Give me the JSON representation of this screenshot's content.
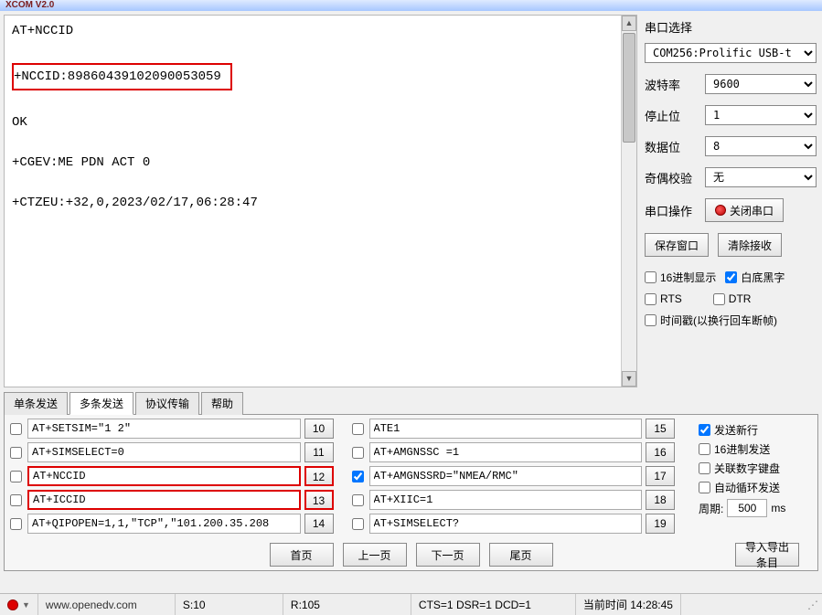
{
  "window_title": "XCOM V2.0",
  "terminal": {
    "lines": [
      "AT+NCCID",
      "",
      "+NCCID:89860439102090053059",
      "",
      "OK",
      "",
      "+CGEV:ME PDN ACT 0",
      "",
      "+CTZEU:+32,0,2023/02/17,06:28:47"
    ],
    "highlight_index": 2
  },
  "side": {
    "title": "串口选择",
    "port": "COM256:Prolific USB-t",
    "baud_label": "波特率",
    "baud": "9600",
    "stop_label": "停止位",
    "stop": "1",
    "data_label": "数据位",
    "data": "8",
    "parity_label": "奇偶校验",
    "parity": "无",
    "op_label": "串口操作",
    "op_button": "关闭串口",
    "save_btn": "保存窗口",
    "clear_btn": "清除接收",
    "hex_disp": "16进制显示",
    "white_text": "白底黑字",
    "hex_disp_checked": false,
    "white_text_checked": true,
    "rts": "RTS",
    "dtr": "DTR",
    "rts_checked": false,
    "dtr_checked": false,
    "ts_label": "时间戳(以换行回车断帧)",
    "ts_checked": false
  },
  "tabs": {
    "items": [
      "单条发送",
      "多条发送",
      "协议传输",
      "帮助"
    ],
    "active": 1
  },
  "send": {
    "left": [
      {
        "checked": false,
        "text": "AT+SETSIM=\"1 2\"",
        "num": "10",
        "mark": false
      },
      {
        "checked": false,
        "text": "AT+SIMSELECT=0",
        "num": "11",
        "mark": false
      },
      {
        "checked": false,
        "text": "AT+NCCID",
        "num": "12",
        "mark": true
      },
      {
        "checked": false,
        "text": "AT+ICCID",
        "num": "13",
        "mark": true
      },
      {
        "checked": false,
        "text": "AT+QIPOPEN=1,1,\"TCP\",\"101.200.35.208",
        "num": "14",
        "mark": false
      }
    ],
    "right": [
      {
        "checked": false,
        "text": "ATE1",
        "num": "15"
      },
      {
        "checked": false,
        "text": "AT+AMGNSSC =1",
        "num": "16"
      },
      {
        "checked": true,
        "text": "AT+AMGNSSRD=\"NMEA/RMC\"",
        "num": "17"
      },
      {
        "checked": false,
        "text": "AT+XIIC=1",
        "num": "18"
      },
      {
        "checked": false,
        "text": "AT+SIMSELECT?",
        "num": "19"
      }
    ],
    "options": {
      "newline": "发送新行",
      "newline_checked": true,
      "hex": "16进制发送",
      "hex_checked": false,
      "numpad": "关联数字键盘",
      "numpad_checked": false,
      "loop": "自动循环发送",
      "loop_checked": false,
      "period_label": "周期:",
      "period_val": "500",
      "period_unit": "ms"
    },
    "pager": {
      "first": "首页",
      "prev": "上一页",
      "next": "下一页",
      "last": "尾页",
      "export": "导入导出条目"
    }
  },
  "status": {
    "url": "www.openedv.com",
    "s": "S:10",
    "r": "R:105",
    "cd": "CTS=1 DSR=1 DCD=1",
    "time": "当前时间 14:28:45"
  }
}
